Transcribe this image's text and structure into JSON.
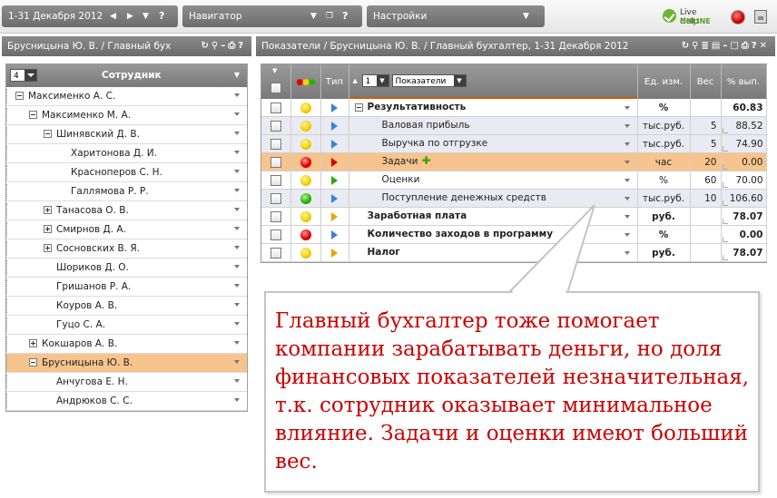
{
  "topbar": {
    "period": "1-31 Декабря 2012",
    "navigator": "Навигатор",
    "settings": "Настройки",
    "live_help_line1": "Live Help",
    "live_help_line2": "ONLINE",
    "help_mark": "?"
  },
  "left_panel": {
    "title": "Брусницына Ю. В. / Главный бух",
    "level": "4",
    "column_title": "Сотрудник",
    "employees": [
      {
        "name": "Максименко А. С."
      },
      {
        "name": "Максименко М. А."
      },
      {
        "name": "Шинявский Д. В."
      },
      {
        "name": "Харитонова Д. И."
      },
      {
        "name": "Красноперов С. Н."
      },
      {
        "name": "Галлямова Р. Р."
      },
      {
        "name": "Танасова О. В."
      },
      {
        "name": "Смирнов Д. А."
      },
      {
        "name": "Сосновских В. Я."
      },
      {
        "name": "Шориков Д. О."
      },
      {
        "name": "Гришанов Р. А."
      },
      {
        "name": "Коуров А. В."
      },
      {
        "name": "Гуцо С. А."
      },
      {
        "name": "Кокшаров А. В."
      },
      {
        "name": "Брусницына Ю. В."
      },
      {
        "name": "Анчугова Е. Н."
      },
      {
        "name": "Андрюков С. С."
      }
    ]
  },
  "right_panel": {
    "title": "Показатели / Брусницына Ю. В. / Главный бухгалтер, 1-31 Декабря 2012",
    "columns": {
      "type": "Тип",
      "level": "1",
      "indicators": "Показатели",
      "unit": "Ед. изм.",
      "weight": "Вес",
      "percent": "% вып."
    },
    "rows": [
      {
        "name": "Результативность",
        "unit": "%",
        "weight": "",
        "percent": "60.83",
        "color": "yellow",
        "arrow": "blue"
      },
      {
        "name": "Валовая прибыль",
        "unit": "тыс.руб.",
        "weight": "5",
        "percent": "88.52",
        "color": "yellow",
        "arrow": "blue"
      },
      {
        "name": "Выручка по отгрузке",
        "unit": "тыс.руб.",
        "weight": "5",
        "percent": "74.90",
        "color": "yellow",
        "arrow": "blue"
      },
      {
        "name": "Задачи",
        "unit": "час",
        "weight": "20",
        "percent": "0.00",
        "color": "red",
        "arrow": "red"
      },
      {
        "name": "Оценки",
        "unit": "%",
        "weight": "60",
        "percent": "70.00",
        "color": "yellow",
        "arrow": "green"
      },
      {
        "name": "Поступление денежных средств",
        "unit": "тыс.руб.",
        "weight": "10",
        "percent": "106.60",
        "color": "green",
        "arrow": "blue"
      },
      {
        "name": "Заработная плата",
        "unit": "руб.",
        "weight": "",
        "percent": "78.07",
        "color": "yellow",
        "arrow": "orange"
      },
      {
        "name": "Количество заходов в программу",
        "unit": "%",
        "weight": "",
        "percent": "0.00",
        "color": "red",
        "arrow": "blue"
      },
      {
        "name": "Налог",
        "unit": "руб.",
        "weight": "",
        "percent": "78.07",
        "color": "yellow",
        "arrow": "orange"
      }
    ]
  },
  "callout": {
    "text": "Главный бухгалтер тоже помогает компании зарабатывать деньги, но доля финансовых показателей незначительная, т.к. сотрудник оказывает минимальное влияние. Задачи и оценки имеют больший вес."
  },
  "colors": {
    "header_gray": "#7d7d7d",
    "selected_row": "#f7c48d",
    "alt_row": "#eaeaf2",
    "callout_text": "#cc0000"
  }
}
